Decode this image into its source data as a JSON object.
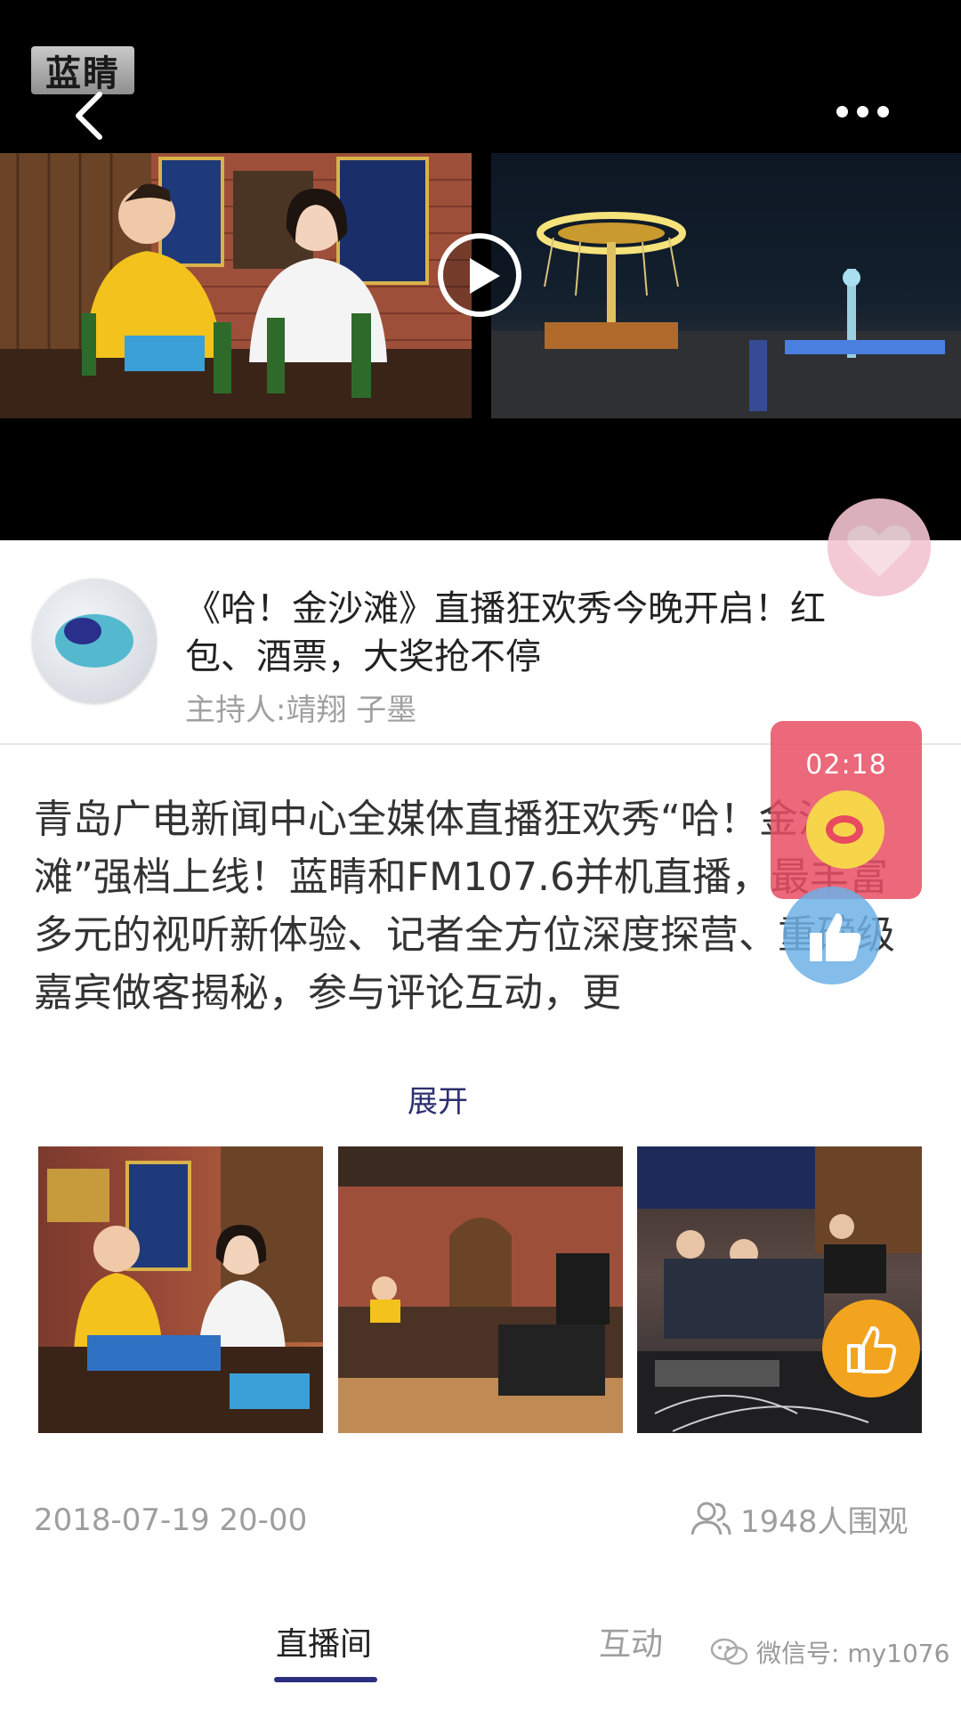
{
  "header": {
    "watermark": "蓝睛",
    "back_icon": "chevron-left-icon",
    "more_icon": "more-dots-icon"
  },
  "video": {
    "play_icon": "play-icon"
  },
  "floating": {
    "timer": "02:18"
  },
  "live": {
    "title": "《哈！金沙滩》直播狂欢秀今晚开启！红包、酒票，大奖抢不停",
    "hosts": "主持人:靖翔 子墨",
    "description": "青岛广电新闻中心全媒体直播狂欢秀“哈！金沙滩”强档上线！蓝睛和FM107.6并机直播，最丰富多元的视听新体验、记者全方位深度探营、重磅级嘉宾做客揭秘，参与评论互动，更",
    "expand_label": "展开",
    "date": "2018-07-19 20-00",
    "viewers": "1948人围观"
  },
  "tabs": [
    {
      "label": "直播间",
      "active": true
    },
    {
      "label": "互动",
      "active": false
    }
  ],
  "footer": {
    "wechat_label": "微信号: my1076"
  },
  "colors": {
    "accent": "#2c2f7e",
    "timer_bg": "#e94e64",
    "like_button": "#f2a41f"
  }
}
